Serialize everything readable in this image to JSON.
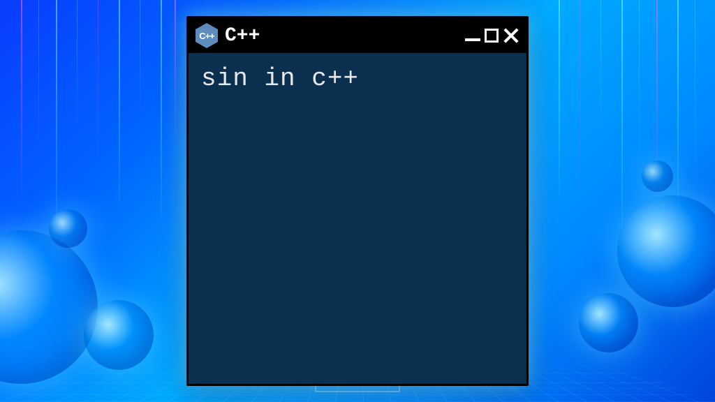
{
  "window": {
    "title": "C++",
    "logo_text": "C++",
    "content": "sin in c++"
  },
  "colors": {
    "terminal_bg": "#0a2f4f",
    "titlebar_bg": "#000000",
    "text": "#e8e8e8",
    "logo_bg": "#5c8dbc",
    "accent_cyan": "#78e6ff",
    "accent_magenta": "#ff64ff"
  }
}
